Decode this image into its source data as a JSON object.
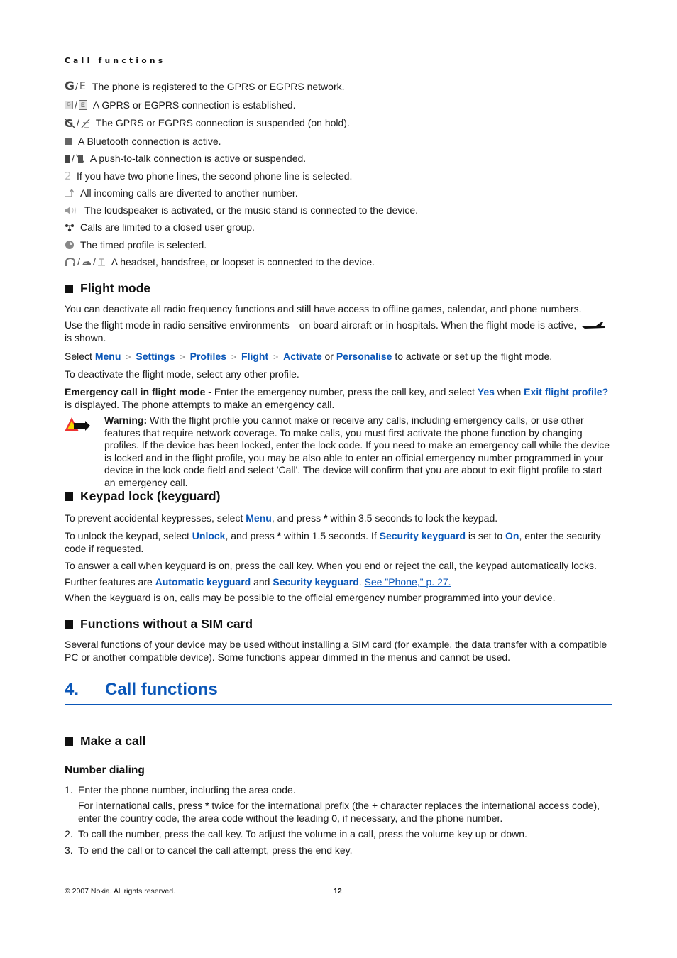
{
  "running_head": "Call functions",
  "indicators": [
    {
      "icons": [
        "gprs-registered-icon",
        "egprs-registered-icon"
      ],
      "glyphs": [
        "G",
        "E"
      ],
      "text": "The phone is registered to the GPRS or EGPRS network."
    },
    {
      "icons": [
        "gprs-connection-icon",
        "egprs-connection-icon"
      ],
      "glyphs": [
        "G",
        "E"
      ],
      "text": "A GPRS or EGPRS connection is established."
    },
    {
      "icons": [
        "gprs-suspended-icon",
        "egprs-suspended-icon"
      ],
      "glyphs": [
        "G",
        "⟋"
      ],
      "text": "The GPRS or EGPRS connection is suspended (on hold)."
    },
    {
      "icons": [
        "bluetooth-icon"
      ],
      "glyphs": [
        "ʙ"
      ],
      "text": "A Bluetooth connection is active."
    },
    {
      "icons": [
        "ptt-active-icon",
        "ptt-suspended-icon"
      ],
      "glyphs": [
        "▮",
        "▮"
      ],
      "text": "A push-to-talk connection is active or suspended."
    },
    {
      "icons": [
        "second-line-icon"
      ],
      "glyphs": [
        "2"
      ],
      "text": "If you have two phone lines, the second phone line is selected."
    },
    {
      "icons": [
        "call-divert-icon"
      ],
      "glyphs": [
        "↑"
      ],
      "text": "All incoming calls are diverted to another number."
    },
    {
      "icons": [
        "loudspeaker-icon"
      ],
      "glyphs": [
        "◁)"
      ],
      "text": "The loudspeaker is activated, or the music stand is connected to the device."
    },
    {
      "icons": [
        "closed-user-group-icon"
      ],
      "glyphs": [
        "⚲"
      ],
      "text": "Calls are limited to a closed user group."
    },
    {
      "icons": [
        "timed-profile-icon"
      ],
      "glyphs": [
        "◔"
      ],
      "text": "The timed profile is selected."
    },
    {
      "icons": [
        "headset-icon",
        "handsfree-icon",
        "loopset-icon"
      ],
      "glyphs": [
        "∩",
        "▲",
        "T"
      ],
      "text": "A headset, handsfree, or loopset is connected to the device."
    }
  ],
  "flight_mode": {
    "heading": "Flight mode",
    "p1": "You can deactivate all radio frequency functions and still have access to offline games, calendar, and phone numbers.",
    "p2_before": "Use the flight mode in radio sensitive environments—on board aircraft or in hospitals. When the flight mode is active,",
    "p2_after": "is shown.",
    "select_label": "Select",
    "path": [
      "Menu",
      "Settings",
      "Profiles",
      "Flight",
      "Activate"
    ],
    "or_label": "or",
    "alt_option": "Personalise",
    "select_tail": "to activate or set up the flight mode.",
    "deactivate": "To deactivate the flight mode, select any other profile.",
    "emergency_label": "Emergency call in flight mode -",
    "emergency_text_1": "Enter the emergency number, press the call key, and select",
    "yes": "Yes",
    "when": "when",
    "exit_prompt": "Exit flight profile?",
    "emergency_text_2": "is displayed. The phone attempts to make an emergency call.",
    "warning_label": "Warning:",
    "warning_text": "With the flight profile you cannot make or receive any calls, including emergency calls, or use other features that require network coverage. To make calls, you must first activate the phone function by changing profiles. If the device has been locked, enter the lock code. If you need to make an emergency call while the device is locked and in the flight profile, you may be also able to enter an official emergency number programmed in your device in the lock code field and select 'Call'. The device will confirm that you are about to exit flight profile to start an emergency call."
  },
  "keypad_lock": {
    "heading": "Keypad lock (keyguard)",
    "p1_a": "To prevent accidental keypresses, select",
    "p1_menu": "Menu",
    "p1_b": ", and press",
    "star": "*",
    "p1_c": "within 3.5 seconds to lock the keypad.",
    "p2_a": "To unlock the keypad, select",
    "p2_unlock": "Unlock",
    "p2_b": ", and press",
    "p2_c": "within 1.5 seconds. If",
    "p2_security": "Security keyguard",
    "p2_d": "is set to",
    "p2_on": "On",
    "p2_e": ", enter the security code if requested.",
    "p3": "To answer a call when keyguard is on, press the call key. When you end or reject the call, the keypad automatically locks.",
    "p4_a": "Further features are",
    "p4_auto": "Automatic keyguard",
    "p4_and": "and",
    "p4_security": "Security keyguard",
    "p4_link": "See \"Phone,\" p. 27.",
    "p5": "When the keyguard is on, calls may be possible to the official emergency number programmed into your device."
  },
  "no_sim": {
    "heading": "Functions without a SIM card",
    "p1": "Several functions of your device may be used without installing a SIM card (for example, the data transfer with a compatible PC or another compatible device). Some functions appear dimmed in the menus and cannot be used."
  },
  "chapter": {
    "number": "4.",
    "title": "Call functions"
  },
  "make_call": {
    "heading": "Make a call",
    "subheading": "Number dialing",
    "steps": [
      {
        "n": "1.",
        "text": "Enter the phone number, including the area code."
      },
      {
        "n": "2.",
        "text": "To call the number, press the call key. To adjust the volume in a call, press the volume key up or down."
      },
      {
        "n": "3.",
        "text": "To end the call or to cancel the call attempt, press the end key."
      }
    ],
    "step1_sub_a": "For international calls, press",
    "step1_sub_b": "twice for the international prefix (the + character replaces the international access code), enter the country code, the area code without the leading 0, if necessary, and the phone number."
  },
  "footer": {
    "copyright": "© 2007 Nokia. All rights reserved.",
    "page_number": "12"
  }
}
